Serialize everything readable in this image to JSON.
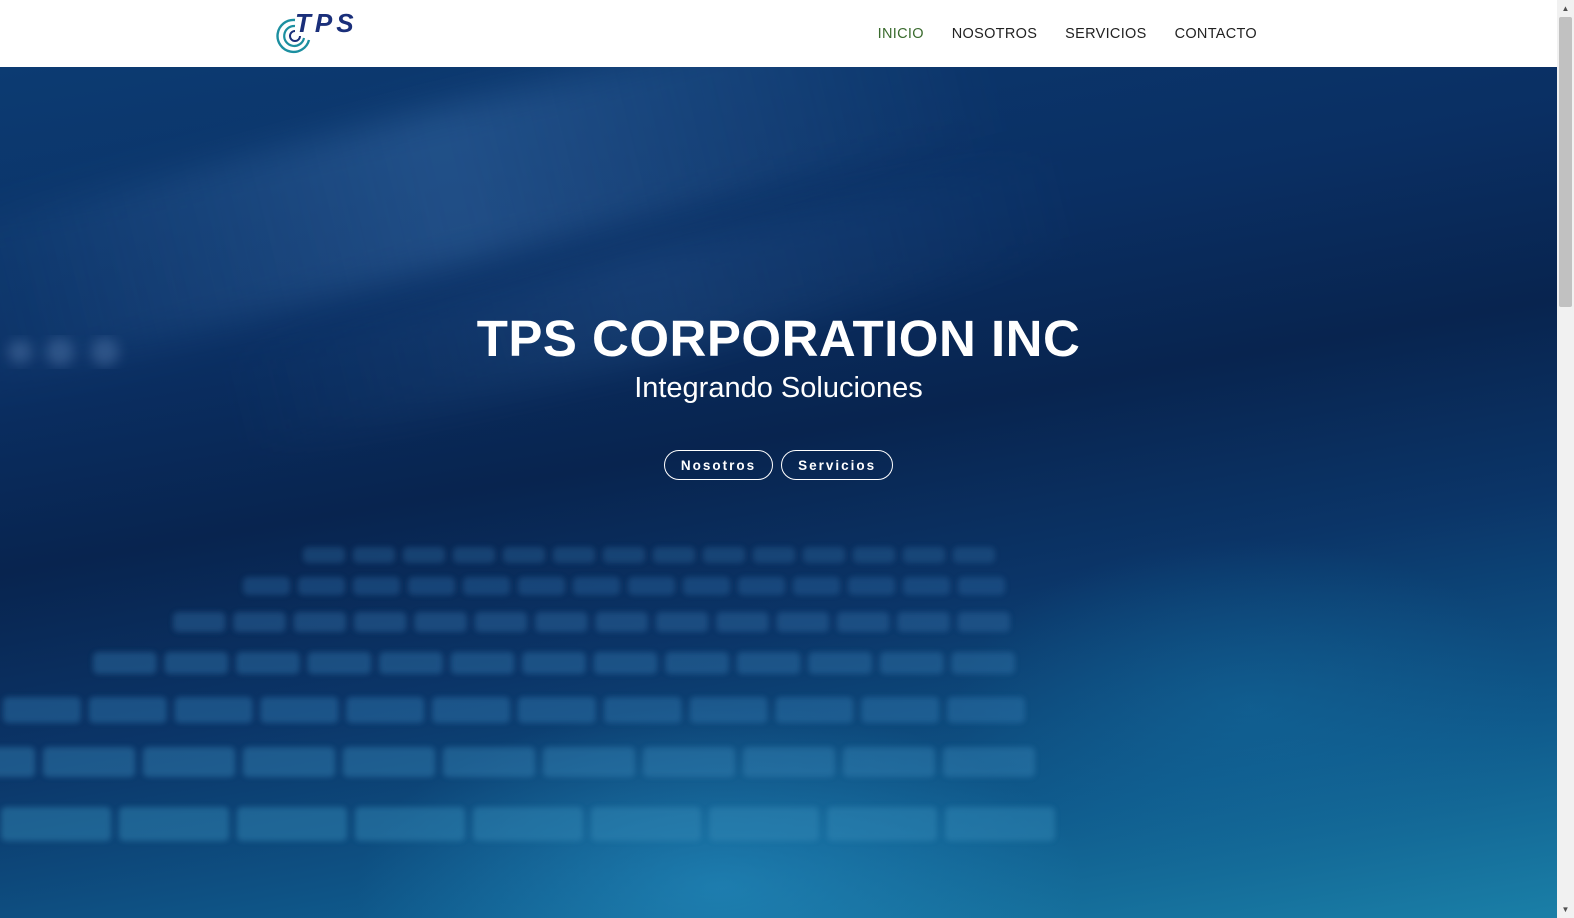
{
  "header": {
    "logo_text": "TPS",
    "nav": [
      {
        "label": "INICIO",
        "active": true
      },
      {
        "label": "NOSOTROS",
        "active": false
      },
      {
        "label": "SERVICIOS",
        "active": false
      },
      {
        "label": "CONTACTO",
        "active": false
      }
    ]
  },
  "hero": {
    "title": "TPS CORPORATION INC",
    "subtitle": "Integrando Soluciones",
    "buttons": [
      {
        "label": "Nosotros"
      },
      {
        "label": "Servicios"
      }
    ]
  },
  "colors": {
    "active_nav": "#3a6b2e",
    "nav_text": "#222222",
    "logo_blue": "#1a2f7a",
    "logo_teal": "#1c8fa0",
    "hero_dark": "#08244f",
    "hero_light": "#1a7fa7"
  },
  "scrollbar": {
    "up_icon": "triangle-up-icon",
    "down_icon": "triangle-down-icon"
  }
}
